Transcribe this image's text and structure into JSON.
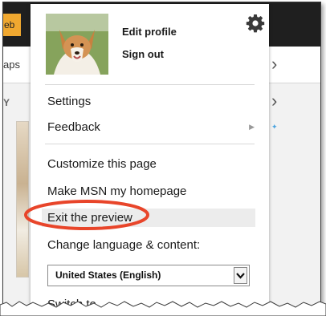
{
  "background": {
    "left_tab_text": "eb",
    "nav_partial_text": "aps",
    "edge_letter": "Y"
  },
  "menu": {
    "profile": {
      "edit_label": "Edit profile",
      "signout_label": "Sign out"
    },
    "items": [
      {
        "label": "Settings"
      },
      {
        "label": "Feedback"
      },
      {
        "label": "Customize this page"
      },
      {
        "label": "Make MSN my homepage"
      },
      {
        "label": "Exit the preview"
      }
    ],
    "language": {
      "label": "Change language & content:",
      "selected": "United States (English)"
    },
    "cut_off_text": "Switch to"
  },
  "colors": {
    "highlight_ring": "#e8452a",
    "top_bar": "#1f1f1f",
    "left_tab": "#f0a830"
  }
}
